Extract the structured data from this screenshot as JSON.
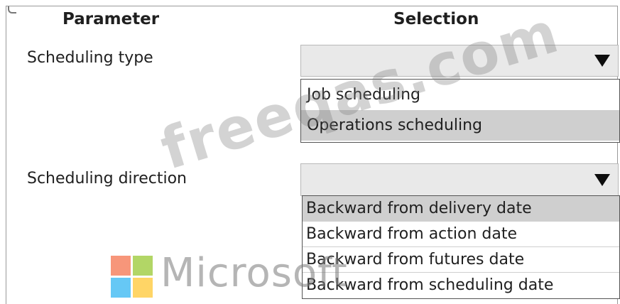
{
  "headers": {
    "parameter": "Parameter",
    "selection": "Selection"
  },
  "rows": [
    {
      "label": "Scheduling type",
      "selected_value": "",
      "options": [
        {
          "label": "Job scheduling",
          "highlighted": false
        },
        {
          "label": "Operations scheduling",
          "highlighted": true
        }
      ]
    },
    {
      "label": "Scheduling direction",
      "selected_value": "",
      "options": [
        {
          "label": "Backward from delivery date",
          "highlighted": true
        },
        {
          "label": "Backward from action date",
          "highlighted": false
        },
        {
          "label": "Backward from futures date",
          "highlighted": false
        },
        {
          "label": "Backward from scheduling date",
          "highlighted": false
        }
      ]
    }
  ],
  "watermark": {
    "site_text": "freeqas.com",
    "brand_text": "Microsoft",
    "logo_colors": [
      "#f25022",
      "#7fba00",
      "#00a4ef",
      "#ffb900"
    ]
  },
  "icons": {
    "dropdown_arrow": "chevron-down-icon"
  }
}
